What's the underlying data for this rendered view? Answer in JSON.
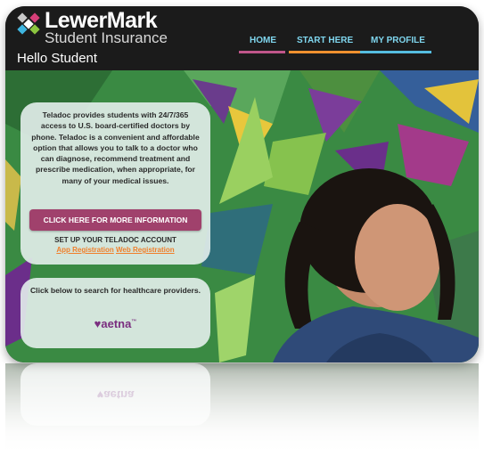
{
  "brand": {
    "title": "LewerMark",
    "subtitle": "Student Insurance",
    "logo_icon": "lewermark-x-logo",
    "colors": {
      "x_green": "#8cc63f",
      "x_pink": "#d63f78",
      "x_blue": "#3fb6e0",
      "x_gray": "#c9c9c9"
    }
  },
  "greeting": "Hello Student",
  "nav": {
    "items": [
      {
        "label": "HOME",
        "underline_color": "#c0568a"
      },
      {
        "label": "START HERE",
        "underline_color": "#f0912f"
      },
      {
        "label": "MY PROFILE",
        "underline_color": "#55bde0"
      }
    ],
    "text_color": "#7fd6ee"
  },
  "teladoc_card": {
    "body": "Teladoc provides students with 24/7/365 access to U.S. board-certified doctors by phone. Teladoc is a convenient and affordable option that allows you to talk to a doctor who can diagnose, recommend treatment and prescribe medication, when appropriate, for many of your medical issues.",
    "cta_label": "CLICK HERE FOR MORE INFORMATION",
    "setup_label": "SET UP YOUR TELADOC ACCOUNT",
    "app_registration": "App Registration",
    "web_registration": "Web Registration"
  },
  "provider_card": {
    "body": "Click below to search for healthcare providers.",
    "aetna_label": "♥aetna",
    "aetna_mark": "™"
  },
  "colors": {
    "topbar": "#1b1b1b",
    "cta": "#a0416c",
    "link": "#f07f2b",
    "aetna": "#7a2e7f"
  }
}
